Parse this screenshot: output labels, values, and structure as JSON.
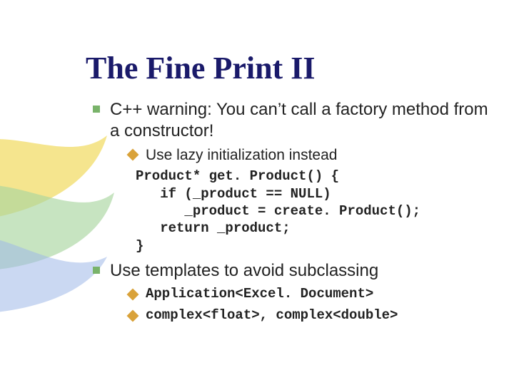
{
  "title": "The Fine Print II",
  "bullets": {
    "b1": "C++ warning: You can’t call a factory method from a constructor!",
    "b1_1": "Use lazy initialization instead",
    "code1_l1": "Product* get. Product() {",
    "code1_l2": "   if (_product == NULL)",
    "code1_l3": "      _product = create. Product();",
    "code1_l4": "   return _product;",
    "code1_l5": "}",
    "b2": "Use templates to avoid subclassing",
    "b2_1": "Application<Excel. Document>",
    "b2_2": "complex<float>, complex<double>"
  }
}
